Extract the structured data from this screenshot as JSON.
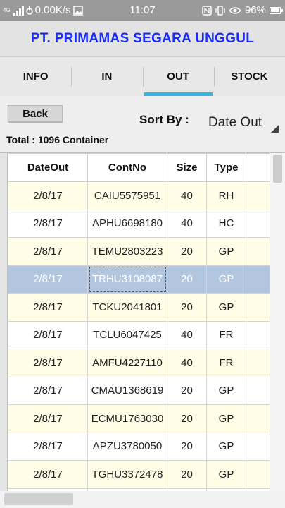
{
  "status_bar": {
    "network": "4G",
    "speed": "0.00K/s",
    "time": "11:07",
    "battery": "96%",
    "icons": [
      "signal-icon",
      "data-saver-icon",
      "image-icon",
      "nfc-icon",
      "vibrate-icon",
      "eye-icon",
      "battery-icon"
    ]
  },
  "header": {
    "title": "PT. PRIMAMAS SEGARA UNGGUL",
    "title_color": "#1a2bff"
  },
  "tabs": [
    {
      "label": "INFO"
    },
    {
      "label": "IN"
    },
    {
      "label": "OUT",
      "active": true
    },
    {
      "label": "STOCK"
    }
  ],
  "tab_indicator_color": "#33b5e5",
  "controls": {
    "back_label": "Back",
    "sort_label": "Sort By  :",
    "sort_value": "Date Out",
    "total_text": "Total : 1096 Container"
  },
  "table": {
    "columns": [
      "DateOut",
      "ContNo",
      "Size",
      "Type"
    ],
    "selected_row": 3,
    "rows": [
      [
        "2/8/17",
        "CAIU5575951",
        "40",
        "RH"
      ],
      [
        "2/8/17",
        "APHU6698180",
        "40",
        "HC"
      ],
      [
        "2/8/17",
        "TEMU2803223",
        "20",
        "GP"
      ],
      [
        "2/8/17",
        "TRHU3108087",
        "20",
        "GP"
      ],
      [
        "2/8/17",
        "TCKU2041801",
        "20",
        "GP"
      ],
      [
        "2/8/17",
        "TCLU6047425",
        "40",
        "FR"
      ],
      [
        "2/8/17",
        "AMFU4227110",
        "40",
        "FR"
      ],
      [
        "2/8/17",
        "CMAU1368619",
        "20",
        "GP"
      ],
      [
        "2/8/17",
        "ECMU1763030",
        "20",
        "GP"
      ],
      [
        "2/8/17",
        "APZU3780050",
        "20",
        "GP"
      ],
      [
        "2/8/17",
        "TGHU3372478",
        "20",
        "GP"
      ],
      [
        "",
        "",
        "",
        ""
      ]
    ]
  },
  "colors": {
    "row_yellow": "#fffde6",
    "row_selected": "#b3c6e0"
  }
}
